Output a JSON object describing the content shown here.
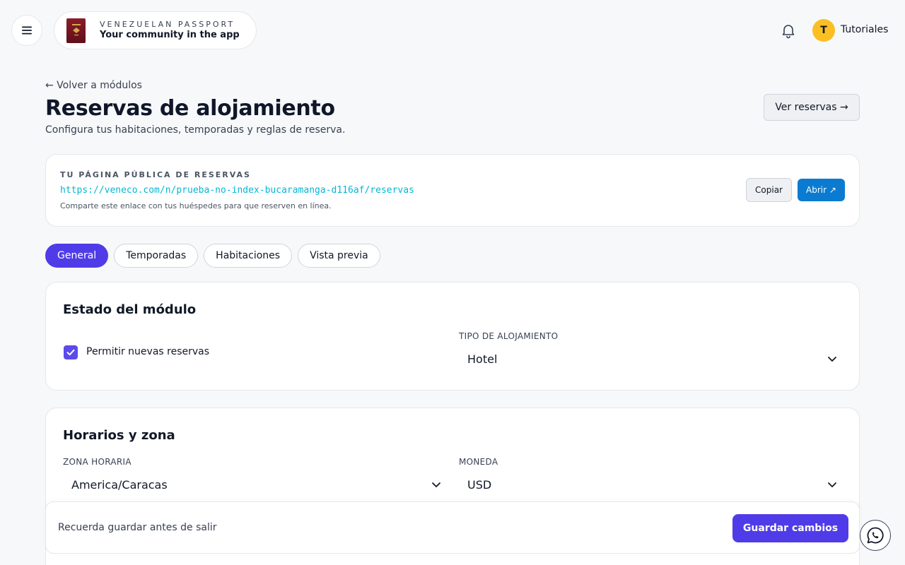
{
  "header": {
    "brand_top": "VENEZUELAN PASSPORT",
    "brand_bottom": "Your community in the app",
    "user_initial": "T",
    "user_name": "Tutoriales"
  },
  "page": {
    "back_link": "← Volver a módulos",
    "title": "Reservas de alojamiento",
    "subtitle": "Configura tus habitaciones, temporadas y reglas de reserva.",
    "view_bookings_button": "Ver reservas →"
  },
  "public_page": {
    "label": "TU PÁGINA PÚBLICA DE RESERVAS",
    "url": "https://veneco.com/n/prueba-no-index-bucaramanga-d116af/reservas",
    "hint": "Comparte este enlace con tus huéspedes para que reserven en línea.",
    "copy_button": "Copiar",
    "open_button": "Abrir ↗"
  },
  "tabs": [
    {
      "label": "General",
      "active": true
    },
    {
      "label": "Temporadas",
      "active": false
    },
    {
      "label": "Habitaciones",
      "active": false
    },
    {
      "label": "Vista previa",
      "active": false
    }
  ],
  "module_status": {
    "title": "Estado del módulo",
    "allow_bookings_label": "Permitir nuevas reservas",
    "allow_bookings_checked": true,
    "accommodation_type_label": "TIPO DE ALOJAMIENTO",
    "accommodation_type_value": "Hotel"
  },
  "schedule": {
    "title": "Horarios y zona",
    "timezone_label": "ZONA HORARIA",
    "timezone_value": "America/Caracas",
    "currency_label": "MONEDA",
    "currency_value": "USD"
  },
  "save_bar": {
    "hint": "Recuerda guardar antes de salir",
    "save_button": "Guardar cambios"
  },
  "colors": {
    "accent": "#4f3ce8",
    "link": "#06b6d4",
    "open_button": "#0a7bd1",
    "avatar": "#fbbf24"
  }
}
